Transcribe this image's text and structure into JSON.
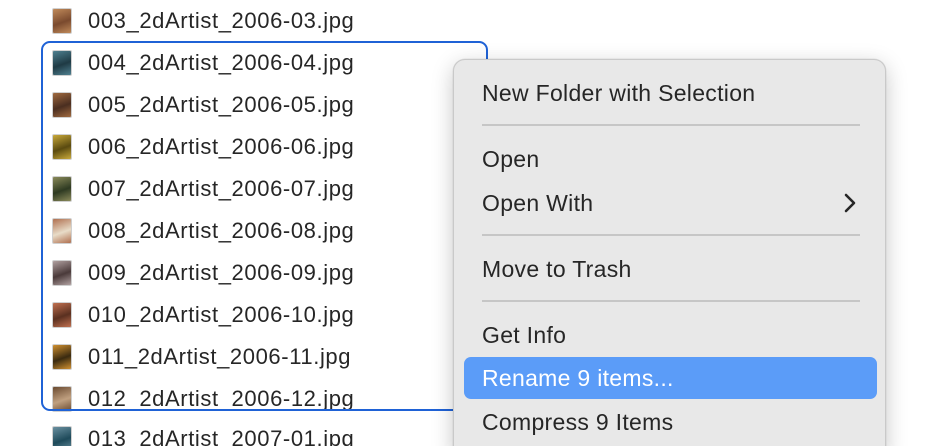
{
  "files": [
    {
      "name": "003_2dArtist_2006-03.jpg",
      "thumb_colors": [
        "#7a4a2e",
        "#c08a5a"
      ]
    },
    {
      "name": "004_2dArtist_2006-04.jpg",
      "thumb_colors": [
        "#1f3a44",
        "#4f8090"
      ]
    },
    {
      "name": "005_2dArtist_2006-05.jpg",
      "thumb_colors": [
        "#4a2e20",
        "#a06a40"
      ]
    },
    {
      "name": "006_2dArtist_2006-06.jpg",
      "thumb_colors": [
        "#5a4a10",
        "#c9a93a"
      ]
    },
    {
      "name": "007_2dArtist_2006-07.jpg",
      "thumb_colors": [
        "#2e3a22",
        "#8a8a5a"
      ]
    },
    {
      "name": "008_2dArtist_2006-08.jpg",
      "thumb_colors": [
        "#e8dcc8",
        "#b07050"
      ]
    },
    {
      "name": "009_2dArtist_2006-09.jpg",
      "thumb_colors": [
        "#4a3a3a",
        "#b0a0a0"
      ]
    },
    {
      "name": "010_2dArtist_2006-10.jpg",
      "thumb_colors": [
        "#5a3020",
        "#c07050"
      ]
    },
    {
      "name": "011_2dArtist_2006-11.jpg",
      "thumb_colors": [
        "#3a2a10",
        "#d09030"
      ]
    },
    {
      "name": "012_2dArtist_2006-12.jpg",
      "thumb_colors": [
        "#c0a080",
        "#6a4a30"
      ]
    },
    {
      "name": "013_2dArtist_2007-01.jpg",
      "thumb_colors": [
        "#1e4a5a",
        "#6a90a0"
      ]
    }
  ],
  "selection": {
    "first_selected": "004_2dArtist_2006-04.jpg",
    "last_selected": "012_2dArtist_2006-12.jpg",
    "color": "#1f62d6"
  },
  "context_menu": {
    "new_folder": "New Folder with Selection",
    "open": "Open",
    "open_with": "Open With",
    "move_to_trash": "Move to Trash",
    "get_info": "Get Info",
    "rename": "Rename 9 items...",
    "compress": "Compress 9 Items",
    "highlight_color": "#5b9cf8"
  }
}
